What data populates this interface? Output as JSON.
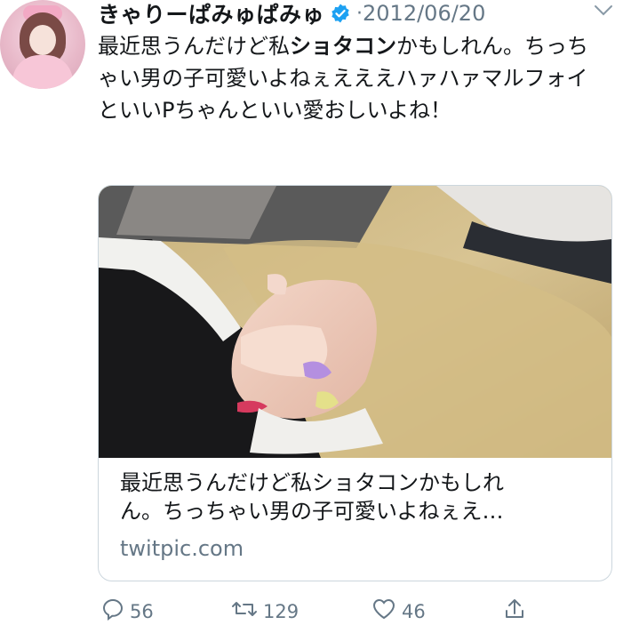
{
  "author": {
    "name": "きゃりーぱみゅぱみゅ",
    "verified": true,
    "separator": "·",
    "date": "2012/06/20"
  },
  "tweet": {
    "text_before": "最近思うんだけど私",
    "text_bold": "ショタコン",
    "text_after": "かもしれん。ちっちゃい男の子可愛いよねぇえええハァハァマルフォイといいPちゃんといい愛おしいよね！"
  },
  "card": {
    "title_line1": "最近思うんだけど私ショタコンかもしれ",
    "title_line2": "ん。ちっちゃい男の子可愛いよねぇえ…",
    "domain": "twitpic.com"
  },
  "actions": {
    "reply_count": "56",
    "retweet_count": "129",
    "like_count": "46"
  },
  "icons": {
    "verified": "verified-badge-icon",
    "caret": "chevron-down-icon",
    "reply": "reply-icon",
    "retweet": "retweet-icon",
    "like": "heart-icon",
    "share": "share-icon"
  },
  "colors": {
    "text": "#14171a",
    "secondary": "#657786",
    "verified": "#1da1f2",
    "border": "#ccd6dd"
  }
}
